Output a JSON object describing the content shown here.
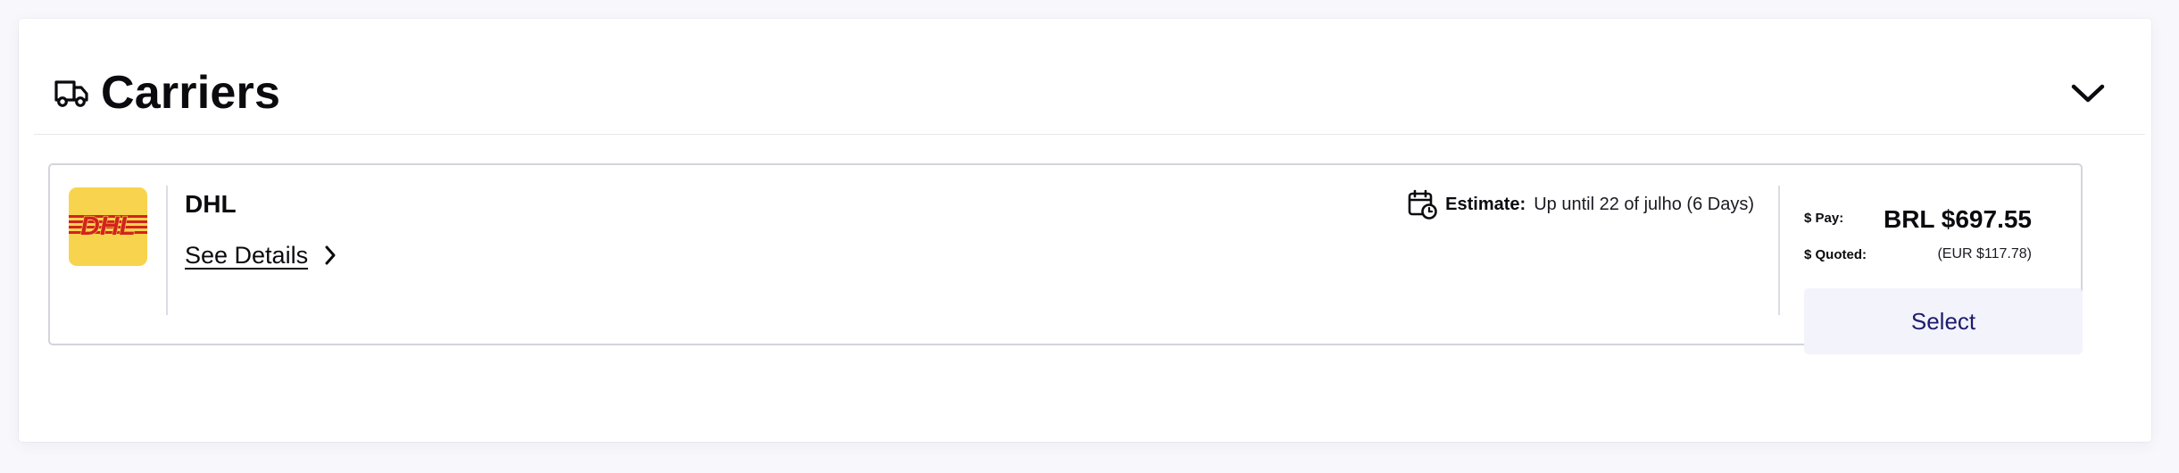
{
  "section": {
    "title": "Carriers",
    "icons": {
      "header": "truck-icon",
      "toggle": "chevron-down-icon"
    }
  },
  "carrier": {
    "name": "DHL",
    "logo_text": "DHL",
    "logo_colors": {
      "background": "#f8d44e",
      "text": "#d2231e"
    },
    "details_label": "See Details",
    "estimate_label": "Estimate:",
    "estimate_value": "Up until 22 of julho (6 Days)",
    "pay_label": "$ Pay:",
    "pay_value": "BRL $697.55",
    "quoted_label": "$ Quoted:",
    "quoted_value": "(EUR $117.78)",
    "select_label": "Select"
  },
  "colors": {
    "panel_bg": "#ffffff",
    "page_bg": "#f8f8fc",
    "select_bg": "#f3f3fb",
    "select_text": "#1c1c6e"
  }
}
